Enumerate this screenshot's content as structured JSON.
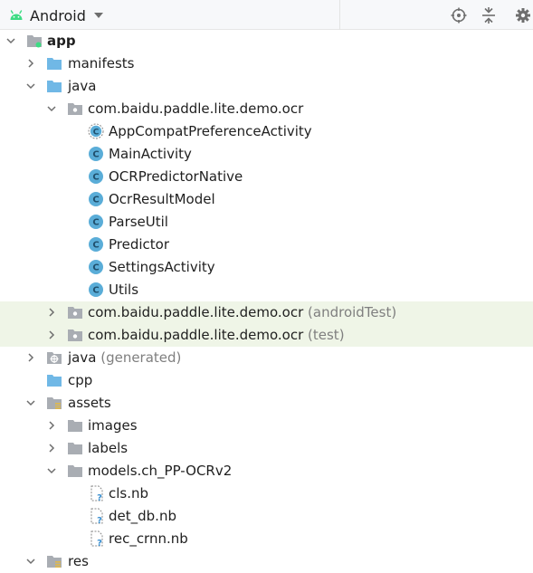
{
  "toolbar": {
    "view_label": "Android",
    "icons": [
      "android-icon",
      "dropdown-caret-icon",
      "locate-icon",
      "collapse-all-icon",
      "settings-gear-icon"
    ]
  },
  "colors": {
    "folder": "#70b8e6",
    "folder_grey": "#a9adb3",
    "class_icon": "#5aadd8",
    "highlight_row": "#eff5e7",
    "android_green": "#3ddc84"
  },
  "tree": {
    "app": "app",
    "manifests": "manifests",
    "java": "java",
    "pkg_main": "com.baidu.paddle.lite.demo.ocr",
    "classes": [
      "AppCompatPreferenceActivity",
      "MainActivity",
      "OCRPredictorNative",
      "OcrResultModel",
      "ParseUtil",
      "Predictor",
      "SettingsActivity",
      "Utils"
    ],
    "pkg_android_test": "com.baidu.paddle.lite.demo.ocr",
    "pkg_android_test_suffix": "(androidTest)",
    "pkg_test": "com.baidu.paddle.lite.demo.ocr",
    "pkg_test_suffix": "(test)",
    "java_generated": "java",
    "java_generated_suffix": "(generated)",
    "cpp": "cpp",
    "assets": "assets",
    "images": "images",
    "labels": "labels",
    "models": "models.ch_PP-OCRv2",
    "model_files": [
      "cls.nb",
      "det_db.nb",
      "rec_crnn.nb"
    ],
    "res": "res"
  }
}
